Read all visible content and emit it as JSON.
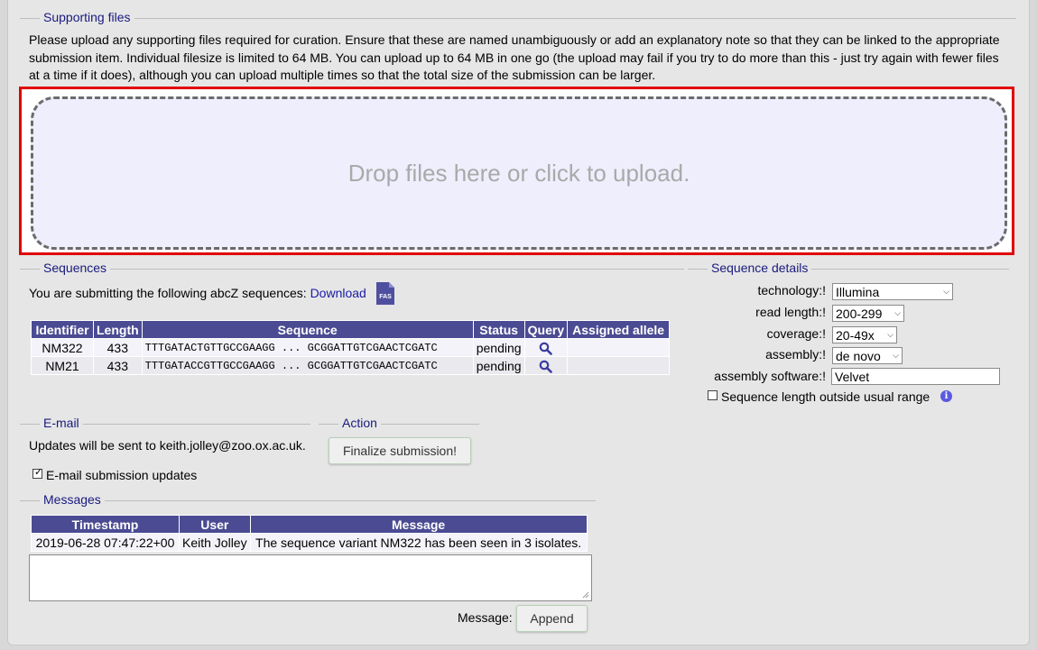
{
  "supporting_files": {
    "legend": "Supporting files",
    "description": "Please upload any supporting files required for curation. Ensure that these are named unambiguously or add an explanatory note so that they can be linked to the appropriate submission item. Individual filesize is limited to 64 MB. You can upload up to 64 MB in one go (the upload may fail if you try to do more than this - just try again with fewer files at a time if it does), although you can upload multiple times so that the total size of the submission can be larger.",
    "dropzone_text": "Drop files here or click to upload."
  },
  "sequences": {
    "legend": "Sequences",
    "intro": "You are submitting the following abcZ sequences:",
    "download_label": "Download",
    "fas_badge": "FAS",
    "columns": [
      "Identifier",
      "Length",
      "Sequence",
      "Status",
      "Query",
      "Assigned allele"
    ],
    "rows": [
      {
        "identifier": "NM322",
        "length": "433",
        "sequence": "TTTGATACTGTTGCCGAAGG ... GCGGATTGTCGAACTCGATC",
        "status": "pending",
        "assigned": ""
      },
      {
        "identifier": "NM21",
        "length": "433",
        "sequence": "TTTGATACCGTTGCCGAAGG ... GCGGATTGTCGAACTCGATC",
        "status": "pending",
        "assigned": ""
      }
    ]
  },
  "sequence_details": {
    "legend": "Sequence details",
    "technology_label": "technology:!",
    "technology_value": "Illumina",
    "read_length_label": "read length:!",
    "read_length_value": "200-299",
    "coverage_label": "coverage:!",
    "coverage_value": "20-49x",
    "assembly_label": "assembly:!",
    "assembly_value": "de novo",
    "assembly_software_label": "assembly software:!",
    "assembly_software_value": "Velvet",
    "outside_range_label": "Sequence length outside usual range",
    "info_glyph": "i"
  },
  "email": {
    "legend": "E-mail",
    "text": "Updates will be sent to keith.jolley@zoo.ox.ac.uk.",
    "checkbox_label": "E-mail submission updates"
  },
  "action": {
    "legend": "Action",
    "finalize_label": "Finalize submission!"
  },
  "messages": {
    "legend": "Messages",
    "columns": [
      "Timestamp",
      "User",
      "Message"
    ],
    "rows": [
      {
        "timestamp": "2019-06-28 07:47:22+00",
        "user": "Keith Jolley",
        "message": "The sequence variant NM322 has been seen in 3 isolates."
      }
    ],
    "message_label": "Message:",
    "append_label": "Append"
  },
  "colors": {
    "accent_red": "#e00000",
    "table_header": "#4b4b93",
    "legend_text": "#1a1a80",
    "dropzone_bg": "#efeefd"
  }
}
